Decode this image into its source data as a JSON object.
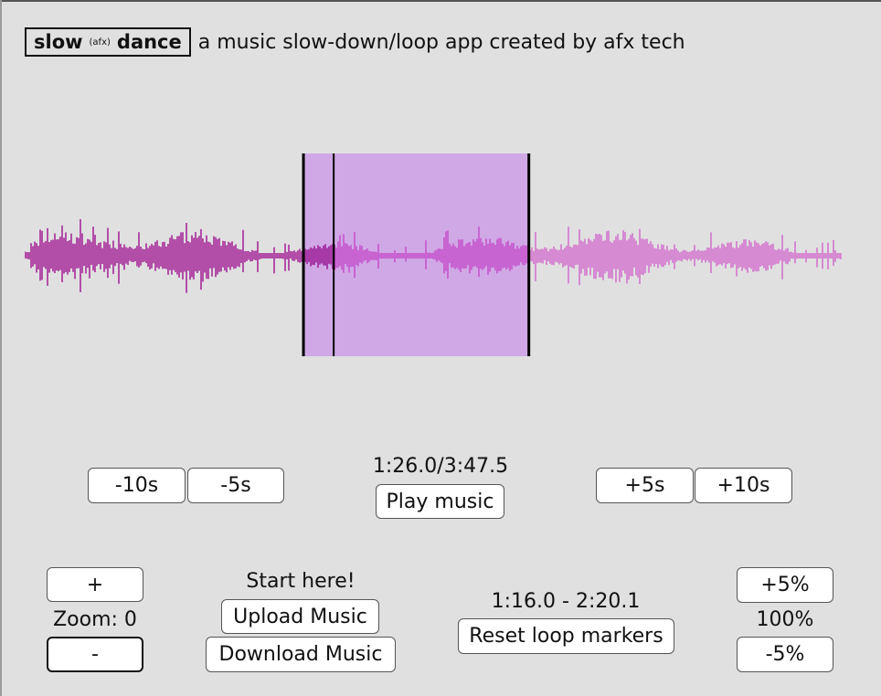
{
  "header": {
    "logo_word1": "slow",
    "logo_small": "(afx)",
    "logo_word2": "dance",
    "tagline": "a music slow-down/loop app created by afx tech"
  },
  "waveform": {
    "colors": {
      "played": "#b24ea8",
      "played_in_loop": "#a83aa8",
      "unplayed_in_loop": "#c864d2",
      "unplayed": "#d68ad2",
      "loop_region": "#d0a8e6",
      "marker": "#000000"
    },
    "loop_start_fraction": 0.3412,
    "loop_end_fraction": 0.6171,
    "playhead_fraction": 0.3782
  },
  "transport": {
    "minus10": "-10s",
    "minus5": "-5s",
    "time_display": "1:26.0/3:47.5",
    "play": "Play music",
    "plus5": "+5s",
    "plus10": "+10s"
  },
  "zoom": {
    "plus": "+",
    "label": "Zoom: 0",
    "minus": "-"
  },
  "file": {
    "start_hint": "Start here!",
    "upload": "Upload Music",
    "download": "Download Music"
  },
  "loop": {
    "range": "1:16.0 - 2:20.1",
    "reset": "Reset loop markers"
  },
  "speed": {
    "plus": "+5%",
    "value": "100%",
    "minus": "-5%"
  }
}
